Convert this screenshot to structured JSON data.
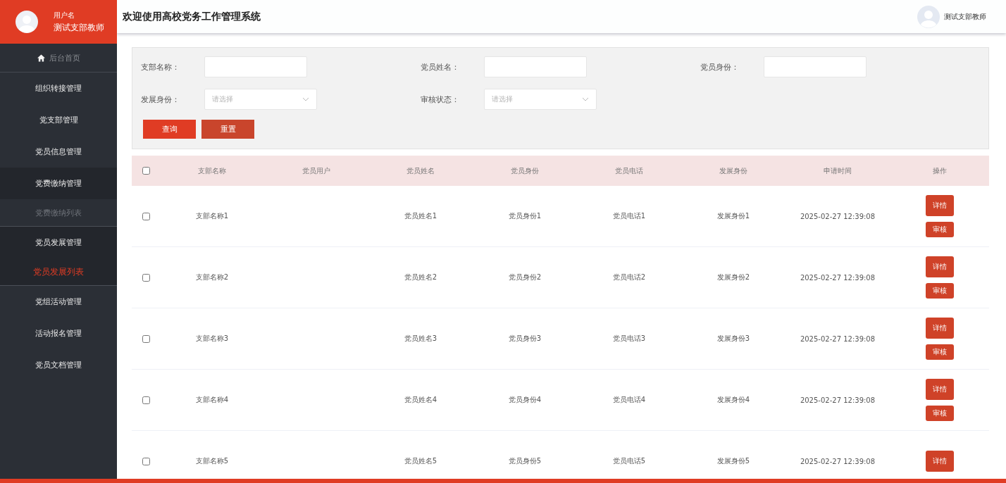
{
  "sidebar": {
    "user": {
      "caption": "用户名",
      "name": "测试支部教师"
    },
    "home": {
      "label": "后台首页"
    },
    "items": [
      {
        "label": "组织转接管理",
        "expanded": false
      },
      {
        "label": "党支部管理",
        "expanded": false
      },
      {
        "label": "党员信息管理",
        "expanded": false
      },
      {
        "label": "党费缴纳管理",
        "expanded": true,
        "children": [
          {
            "label": "党费缴纳列表",
            "selected": false
          }
        ]
      },
      {
        "label": "党员发展管理",
        "expanded": true,
        "children": [
          {
            "label": "党员发展列表",
            "selected": true
          }
        ]
      },
      {
        "label": "党组活动管理",
        "expanded": false
      },
      {
        "label": "活动报名管理",
        "expanded": false
      },
      {
        "label": "党员文档管理",
        "expanded": false
      }
    ]
  },
  "header": {
    "title": "欢迎使用高校党务工作管理系统",
    "user": "测试支部教师"
  },
  "filters": [
    {
      "kind": "text",
      "label": "支部名称："
    },
    {
      "kind": "text",
      "label": "党员姓名："
    },
    {
      "kind": "text",
      "label": "党员身份："
    },
    {
      "kind": "select",
      "label": "发展身份：",
      "placeholder": "请选择"
    },
    {
      "kind": "select",
      "label": "审核状态：",
      "placeholder": "请选择"
    }
  ],
  "buttons": [
    {
      "label": "查询",
      "kind": "primary"
    },
    {
      "label": "重置",
      "kind": "secondary"
    }
  ],
  "table": {
    "select_all": {
      "checked": false
    },
    "columns": [
      "支部名称",
      "党员用户",
      "党员姓名",
      "党员身份",
      "党员电话",
      "发展身份",
      "申请时间",
      "操作"
    ],
    "rows": [
      {
        "checked": false,
        "cells": [
          "支部名称1",
          "",
          "党员姓名1",
          "党员身份1",
          "党员电话1",
          "发展身份1",
          "2025-02-27 12:39:08"
        ],
        "actions": [
          "详情",
          "审核"
        ]
      },
      {
        "checked": false,
        "cells": [
          "支部名称2",
          "",
          "党员姓名2",
          "党员身份2",
          "党员电话2",
          "发展身份2",
          "2025-02-27 12:39:08"
        ],
        "actions": [
          "详情",
          "审核"
        ]
      },
      {
        "checked": false,
        "cells": [
          "支部名称3",
          "",
          "党员姓名3",
          "党员身份3",
          "党员电话3",
          "发展身份3",
          "2025-02-27 12:39:08"
        ],
        "actions": [
          "详情",
          "审核"
        ]
      },
      {
        "checked": false,
        "cells": [
          "支部名称4",
          "",
          "党员姓名4",
          "党员身份4",
          "党员电话4",
          "发展身份4",
          "2025-02-27 12:39:08"
        ],
        "actions": [
          "详情",
          "审核"
        ]
      },
      {
        "checked": false,
        "cells": [
          "支部名称5",
          "",
          "党员姓名5",
          "党员身份5",
          "党员电话5",
          "发展身份5",
          "2025-02-27 12:39:08"
        ],
        "actions": [
          "详情"
        ]
      }
    ]
  }
}
